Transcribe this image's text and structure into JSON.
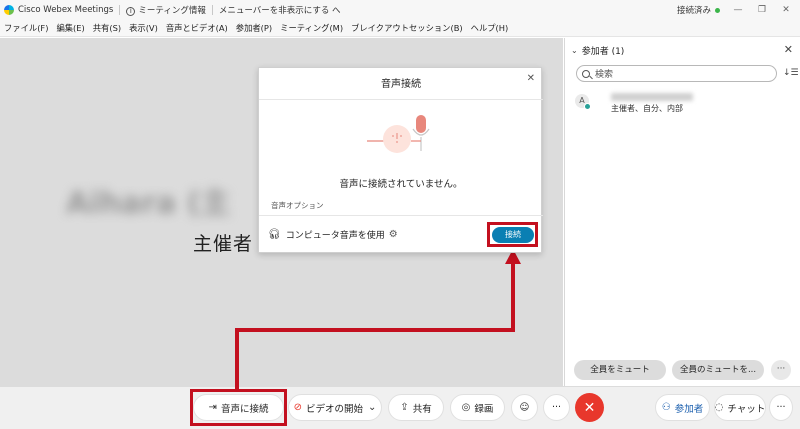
{
  "titlebar": {
    "app_name": "Cisco Webex Meetings",
    "meeting_info": "ミーティング情報",
    "hide_menu": "メニューバーを非表示にする へ",
    "status": "接続済み"
  },
  "menu": [
    "ファイル(F)",
    "編集(E)",
    "共有(S)",
    "表示(V)",
    "音声とビデオ(A)",
    "参加者(P)",
    "ミーティング(M)",
    "ブレイクアウトセッション(B)",
    "ヘルプ(H)"
  ],
  "stage": {
    "blurred_name": "Aihara (主",
    "host_label": "主催者"
  },
  "panel": {
    "title": "参加者 (1)",
    "search_placeholder": "検索",
    "participant": {
      "avatar_initial": "A",
      "role": "主催者、自分、内部"
    },
    "mute_all": "全員をミュート",
    "unmute_all": "全員のミュートを...",
    "more": "···"
  },
  "dialog": {
    "title": "音声接続",
    "status": "音声に接続されていません。",
    "options_label": "音声オプション",
    "computer_audio": "コンピュータ音声を使用",
    "connect": "接続"
  },
  "toolbar": {
    "audio": "音声に接続",
    "video": "ビデオの開始",
    "share": "共有",
    "record": "録画",
    "react": "☺",
    "more": "···",
    "end": "✕",
    "participants": "参加者",
    "chat": "チャット",
    "more2": "···"
  },
  "colors": {
    "highlight": "#c3101f",
    "connect_button": "#0a7fb3",
    "end_button": "#e8372c",
    "status_dot": "#3bb54a"
  }
}
